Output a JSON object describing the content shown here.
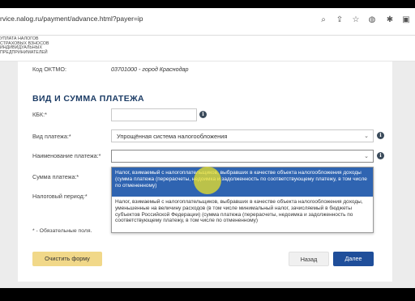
{
  "browser": {
    "url": "rvice.nalog.ru/payment/advance.html?payer=ip"
  },
  "site": {
    "logo_lines": [
      "Уплата налогов",
      "страховых взносов",
      "индивидуальных",
      "предпринимателей"
    ]
  },
  "form": {
    "oktmo_label": "Код ОКТМО:",
    "oktmo_value": "03701000 - город Краснодар",
    "section_title": "ВИД И СУММА ПЛАТЕЖА",
    "kbk_label": "КБК:*",
    "kbk_value": "",
    "payment_type_label": "Вид платежа:*",
    "payment_type_value": "Упрощённая система налогообложения",
    "payment_name_label": "Наименование платежа:*",
    "payment_name_value": "",
    "amount_label": "Сумма платежа:*",
    "period_label": "Налоговый период:*",
    "required_note": "* - Обязательные поля."
  },
  "dropdown": {
    "options": [
      "Налог, взимаемый с налогоплательщиков, выбравших в качестве объекта налогообложения доходы (сумма платежа (перерасчеты, недоимка и задолженность по соответствующему платежу, в том числе по отмененному)",
      "Налог, взимаемый с налогоплательщиков, выбравших в качестве объекта налогообложения доходы, уменьшенные на величину расходов (в том числе минимальный налог, зачисляемый в бюджеты субъектов Российской Федерации) (сумма платежа (перерасчеты, недоимка и задолженность по соответствующему платежу, в том числе по отмененному)"
    ],
    "selected_index": 0
  },
  "buttons": {
    "clear": "Очистить форму",
    "back": "Назад",
    "next": "Далее"
  },
  "colors": {
    "section_title": "#1d3d66",
    "selected_option": "#2f64b1",
    "next_button": "#1f4e9a",
    "clear_button": "#f1d889"
  }
}
